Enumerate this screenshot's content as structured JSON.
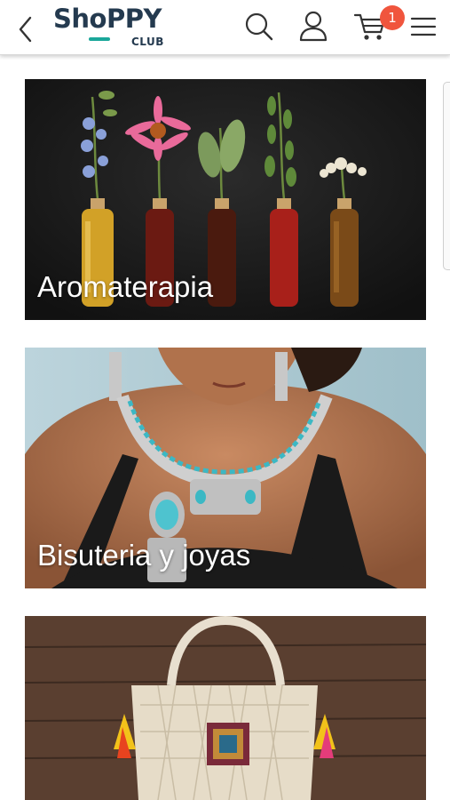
{
  "header": {
    "logo_main": "ShoPPY",
    "logo_sub": "CLUB",
    "cart_count": "1",
    "icons": [
      "back-arrow-icon",
      "search-icon",
      "user-icon",
      "cart-icon",
      "menu-icon"
    ],
    "colors": {
      "logo_text": "#243a4f",
      "logo_accent": "#1aa79a",
      "badge": "#f0553d"
    }
  },
  "categories": [
    {
      "label": "Aromaterapia"
    },
    {
      "label": "Bisuteria y joyas"
    },
    {
      "label": ""
    }
  ]
}
